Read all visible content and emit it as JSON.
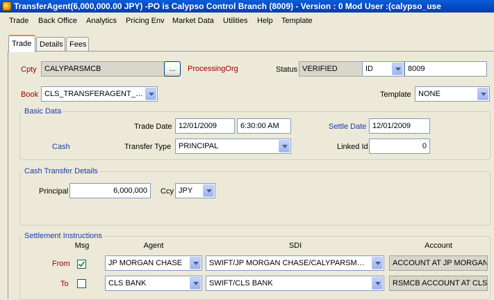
{
  "window": {
    "title": "TransferAgent(6,000,000.00 JPY)  -PO is Calypso Control Branch  (8009) - Version : 0 Mod User :(calypso_use"
  },
  "menu": [
    "Trade",
    "Back Office",
    "Analytics",
    "Pricing Env",
    "Market Data",
    "Utilities",
    "Help",
    "Template"
  ],
  "tabs": [
    "Trade",
    "Details",
    "Fees"
  ],
  "header": {
    "cpty_label": "Cpty",
    "cpty_value": "CALYPARSMCB",
    "browse_label": "...",
    "processing_org_label": "ProcessingOrg",
    "status_label": "Status",
    "status_value": "VERIFIED",
    "id_type": "ID",
    "id_value": "8009",
    "book_label": "Book",
    "book_value": "CLS_TRANSFERAGENT_BOOK",
    "template_label": "Template",
    "template_value": "NONE"
  },
  "basic_data": {
    "title": "Basic Data",
    "trade_date_label": "Trade Date",
    "trade_date": "12/01/2009",
    "trade_time": "6:30:00 AM",
    "settle_date_label": "Settle Date",
    "settle_date": "12/01/2009",
    "cash_label": "Cash",
    "transfer_type_label": "Transfer Type",
    "transfer_type": "PRINCIPAL",
    "linked_id_label": "Linked Id",
    "linked_id": "0"
  },
  "cash_transfer": {
    "title": "Cash Transfer Details",
    "principal_label": "Principal",
    "principal": "6,000,000",
    "ccy_label": "Ccy",
    "ccy": "JPY"
  },
  "settlement": {
    "title": "Settlement Instructions",
    "col_msg": "Msg",
    "col_agent": "Agent",
    "col_sdi": "SDI",
    "col_account": "Account",
    "rows": [
      {
        "label": "From",
        "checked": true,
        "agent": "JP MORGAN CHASE",
        "sdi": "SWIFT/JP MORGAN CHASE/CALYPARSMCB C...",
        "account": "ACCOUNT AT JP MORGAN"
      },
      {
        "label": "To",
        "checked": false,
        "agent": "CLS BANK",
        "sdi": "SWIFT/CLS BANK",
        "account": "RSMCB ACCOUNT AT CLS"
      }
    ]
  }
}
